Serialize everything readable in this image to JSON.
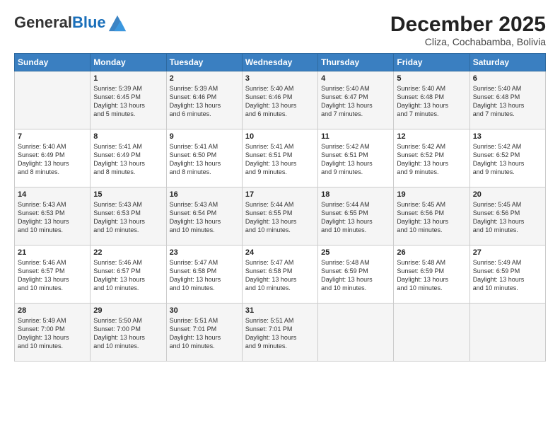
{
  "header": {
    "logo_general": "General",
    "logo_blue": "Blue",
    "month_title": "December 2025",
    "subtitle": "Cliza, Cochabamba, Bolivia"
  },
  "days_of_week": [
    "Sunday",
    "Monday",
    "Tuesday",
    "Wednesday",
    "Thursday",
    "Friday",
    "Saturday"
  ],
  "weeks": [
    [
      {
        "day": "",
        "content": ""
      },
      {
        "day": "1",
        "content": "Sunrise: 5:39 AM\nSunset: 6:45 PM\nDaylight: 13 hours\nand 5 minutes."
      },
      {
        "day": "2",
        "content": "Sunrise: 5:39 AM\nSunset: 6:46 PM\nDaylight: 13 hours\nand 6 minutes."
      },
      {
        "day": "3",
        "content": "Sunrise: 5:40 AM\nSunset: 6:46 PM\nDaylight: 13 hours\nand 6 minutes."
      },
      {
        "day": "4",
        "content": "Sunrise: 5:40 AM\nSunset: 6:47 PM\nDaylight: 13 hours\nand 7 minutes."
      },
      {
        "day": "5",
        "content": "Sunrise: 5:40 AM\nSunset: 6:48 PM\nDaylight: 13 hours\nand 7 minutes."
      },
      {
        "day": "6",
        "content": "Sunrise: 5:40 AM\nSunset: 6:48 PM\nDaylight: 13 hours\nand 7 minutes."
      }
    ],
    [
      {
        "day": "7",
        "content": "Sunrise: 5:40 AM\nSunset: 6:49 PM\nDaylight: 13 hours\nand 8 minutes."
      },
      {
        "day": "8",
        "content": "Sunrise: 5:41 AM\nSunset: 6:49 PM\nDaylight: 13 hours\nand 8 minutes."
      },
      {
        "day": "9",
        "content": "Sunrise: 5:41 AM\nSunset: 6:50 PM\nDaylight: 13 hours\nand 8 minutes."
      },
      {
        "day": "10",
        "content": "Sunrise: 5:41 AM\nSunset: 6:51 PM\nDaylight: 13 hours\nand 9 minutes."
      },
      {
        "day": "11",
        "content": "Sunrise: 5:42 AM\nSunset: 6:51 PM\nDaylight: 13 hours\nand 9 minutes."
      },
      {
        "day": "12",
        "content": "Sunrise: 5:42 AM\nSunset: 6:52 PM\nDaylight: 13 hours\nand 9 minutes."
      },
      {
        "day": "13",
        "content": "Sunrise: 5:42 AM\nSunset: 6:52 PM\nDaylight: 13 hours\nand 9 minutes."
      }
    ],
    [
      {
        "day": "14",
        "content": "Sunrise: 5:43 AM\nSunset: 6:53 PM\nDaylight: 13 hours\nand 10 minutes."
      },
      {
        "day": "15",
        "content": "Sunrise: 5:43 AM\nSunset: 6:53 PM\nDaylight: 13 hours\nand 10 minutes."
      },
      {
        "day": "16",
        "content": "Sunrise: 5:43 AM\nSunset: 6:54 PM\nDaylight: 13 hours\nand 10 minutes."
      },
      {
        "day": "17",
        "content": "Sunrise: 5:44 AM\nSunset: 6:55 PM\nDaylight: 13 hours\nand 10 minutes."
      },
      {
        "day": "18",
        "content": "Sunrise: 5:44 AM\nSunset: 6:55 PM\nDaylight: 13 hours\nand 10 minutes."
      },
      {
        "day": "19",
        "content": "Sunrise: 5:45 AM\nSunset: 6:56 PM\nDaylight: 13 hours\nand 10 minutes."
      },
      {
        "day": "20",
        "content": "Sunrise: 5:45 AM\nSunset: 6:56 PM\nDaylight: 13 hours\nand 10 minutes."
      }
    ],
    [
      {
        "day": "21",
        "content": "Sunrise: 5:46 AM\nSunset: 6:57 PM\nDaylight: 13 hours\nand 10 minutes."
      },
      {
        "day": "22",
        "content": "Sunrise: 5:46 AM\nSunset: 6:57 PM\nDaylight: 13 hours\nand 10 minutes."
      },
      {
        "day": "23",
        "content": "Sunrise: 5:47 AM\nSunset: 6:58 PM\nDaylight: 13 hours\nand 10 minutes."
      },
      {
        "day": "24",
        "content": "Sunrise: 5:47 AM\nSunset: 6:58 PM\nDaylight: 13 hours\nand 10 minutes."
      },
      {
        "day": "25",
        "content": "Sunrise: 5:48 AM\nSunset: 6:59 PM\nDaylight: 13 hours\nand 10 minutes."
      },
      {
        "day": "26",
        "content": "Sunrise: 5:48 AM\nSunset: 6:59 PM\nDaylight: 13 hours\nand 10 minutes."
      },
      {
        "day": "27",
        "content": "Sunrise: 5:49 AM\nSunset: 6:59 PM\nDaylight: 13 hours\nand 10 minutes."
      }
    ],
    [
      {
        "day": "28",
        "content": "Sunrise: 5:49 AM\nSunset: 7:00 PM\nDaylight: 13 hours\nand 10 minutes."
      },
      {
        "day": "29",
        "content": "Sunrise: 5:50 AM\nSunset: 7:00 PM\nDaylight: 13 hours\nand 10 minutes."
      },
      {
        "day": "30",
        "content": "Sunrise: 5:51 AM\nSunset: 7:01 PM\nDaylight: 13 hours\nand 10 minutes."
      },
      {
        "day": "31",
        "content": "Sunrise: 5:51 AM\nSunset: 7:01 PM\nDaylight: 13 hours\nand 9 minutes."
      },
      {
        "day": "",
        "content": ""
      },
      {
        "day": "",
        "content": ""
      },
      {
        "day": "",
        "content": ""
      }
    ]
  ]
}
